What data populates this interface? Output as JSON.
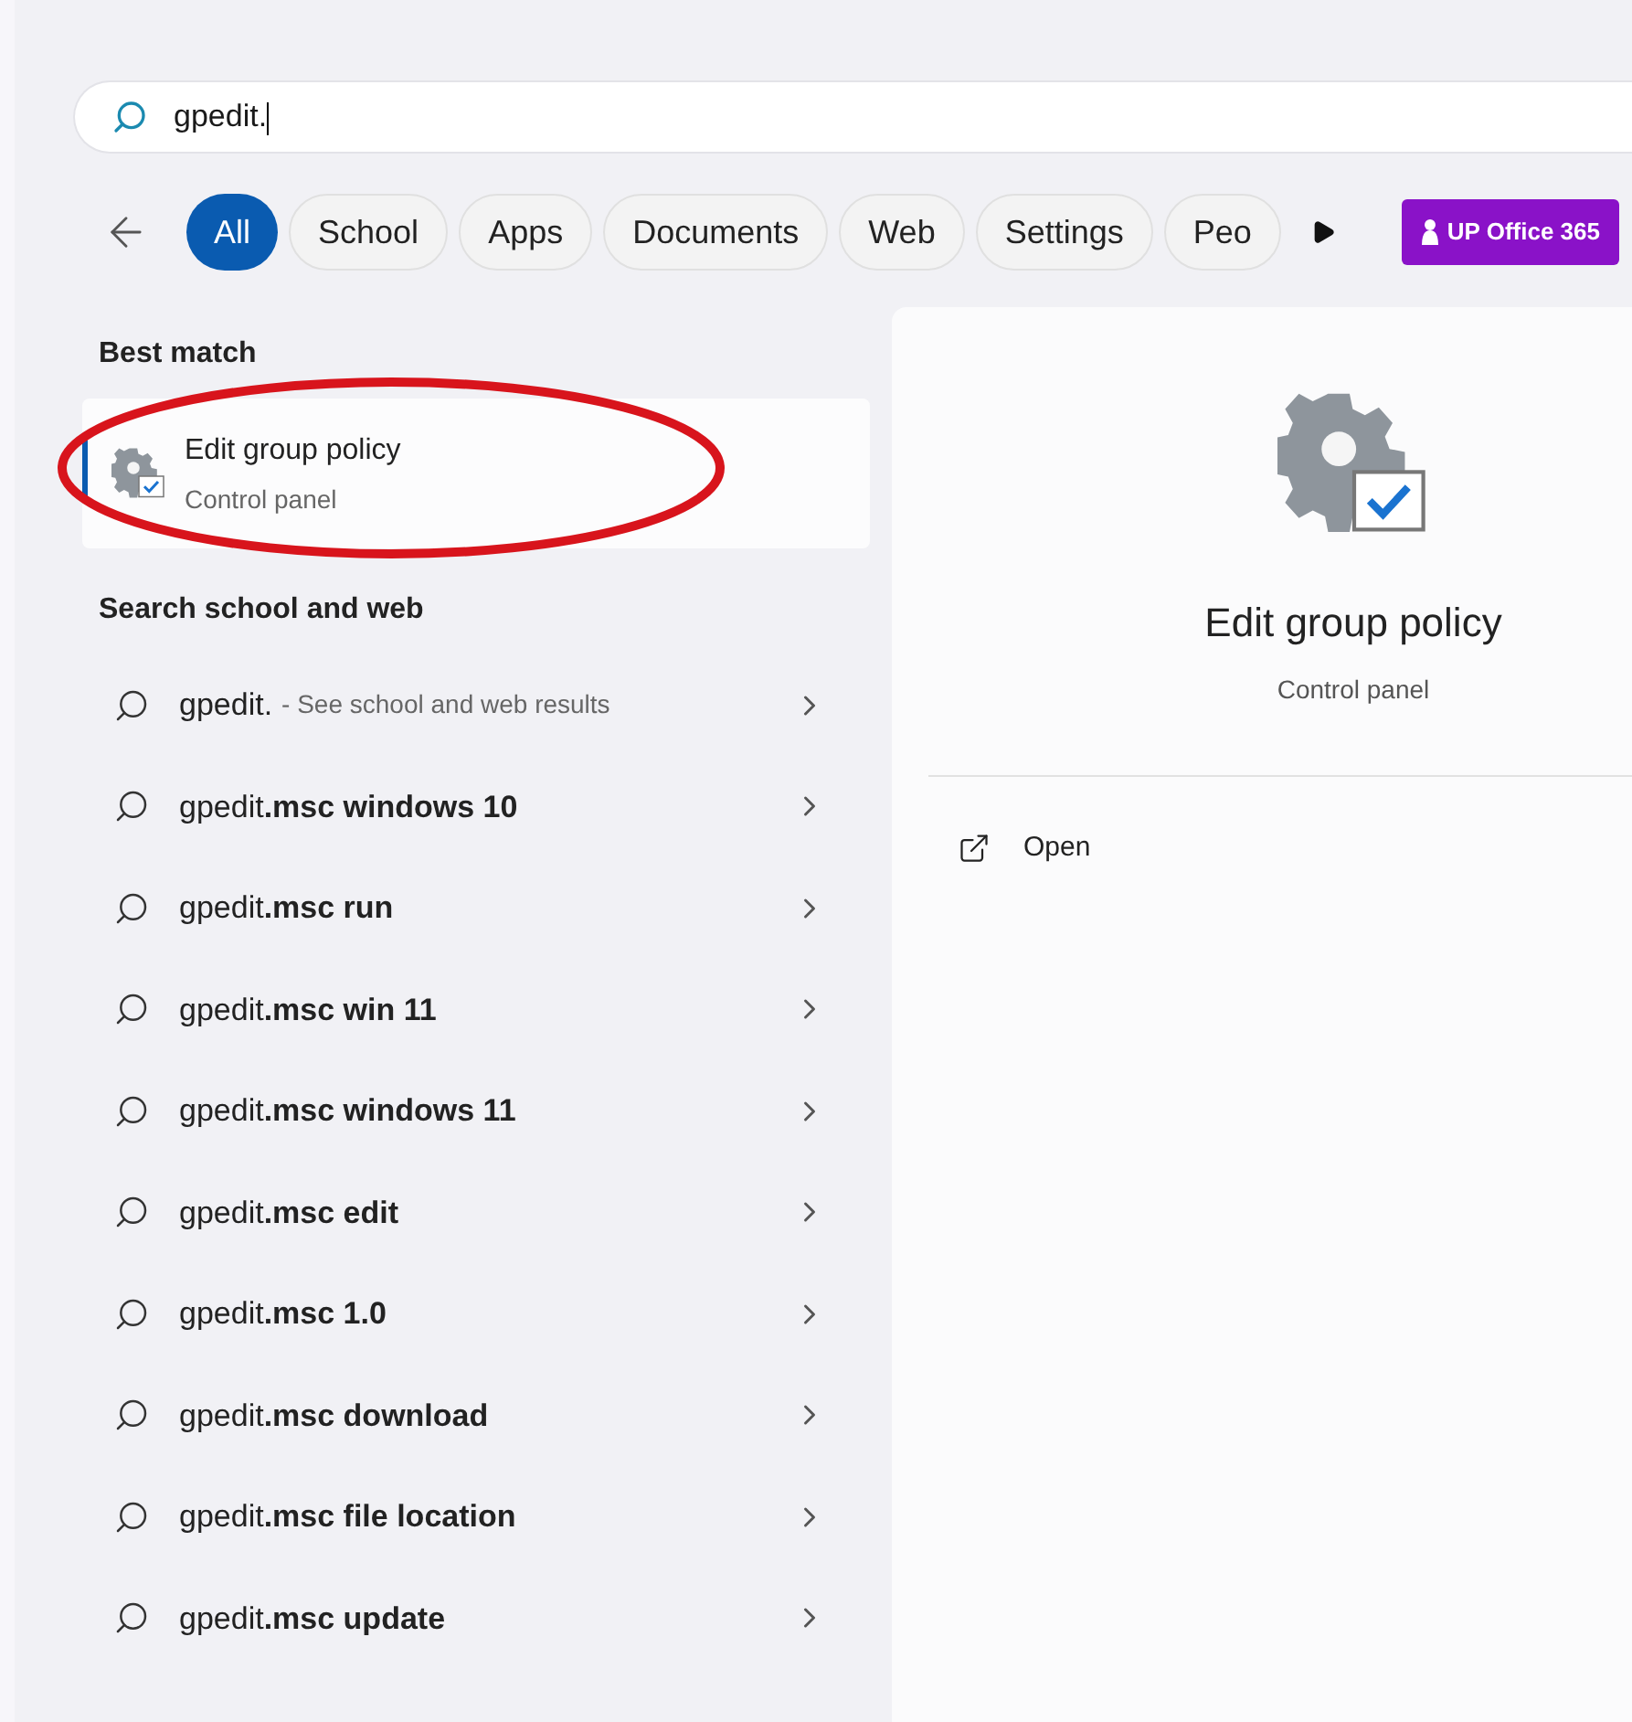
{
  "search": {
    "value": "gpedit."
  },
  "filters": [
    {
      "label": "All",
      "selected": true
    },
    {
      "label": "School",
      "selected": false
    },
    {
      "label": "Apps",
      "selected": false
    },
    {
      "label": "Documents",
      "selected": false
    },
    {
      "label": "Web",
      "selected": false
    },
    {
      "label": "Settings",
      "selected": false
    },
    {
      "label": "Peo",
      "selected": false
    }
  ],
  "promo": {
    "label": "UP Office 365"
  },
  "best_match": {
    "heading": "Best match",
    "title": "Edit group policy",
    "subtitle": "Control panel",
    "selected": true
  },
  "web": {
    "heading": "Search school and web",
    "items": [
      {
        "text": "gpedit.",
        "hint": "- See school and web results"
      },
      {
        "text": "gpedit**.msc windows 10**"
      },
      {
        "text": "gpedit**.msc run**"
      },
      {
        "text": "gpedit**.msc win 11**"
      },
      {
        "text": "gpedit**.msc windows 11**"
      },
      {
        "text": "gpedit**.msc edit**"
      },
      {
        "text": "gpedit**.msc 1.0**"
      },
      {
        "text": "gpedit**.msc download**"
      },
      {
        "text": "gpedit**.msc file location**"
      },
      {
        "text": "gpedit**.msc update**"
      }
    ]
  },
  "detail": {
    "title": "Edit group policy",
    "subtitle": "Control panel",
    "actions": [
      {
        "label": "Open"
      }
    ]
  }
}
